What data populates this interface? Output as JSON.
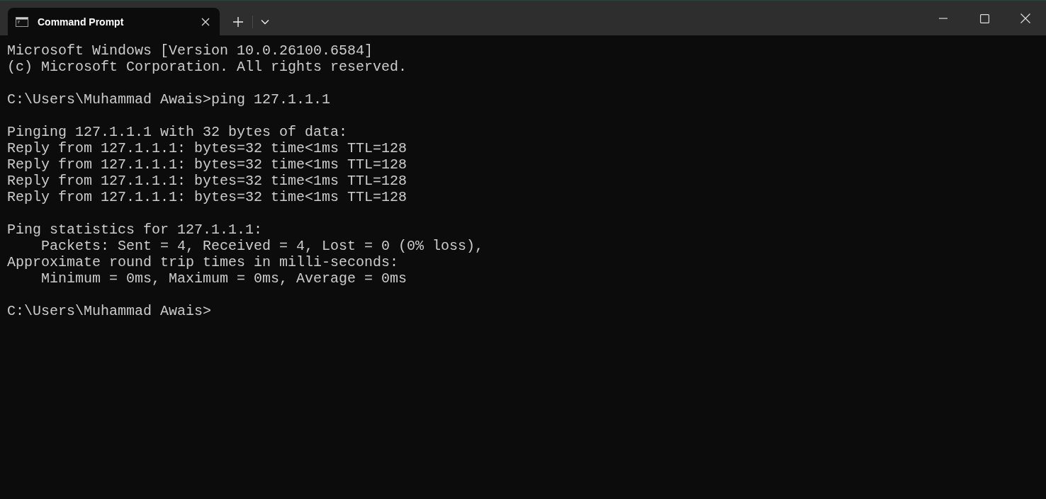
{
  "tabs": [
    {
      "title": "Command Prompt",
      "selected": true
    }
  ],
  "console": {
    "blocks": [
      [
        "Microsoft Windows [Version 10.0.26100.6584]",
        "(c) Microsoft Corporation. All rights reserved."
      ],
      [
        "C:\\Users\\Muhammad Awais>ping 127.1.1.1"
      ],
      [
        "Pinging 127.1.1.1 with 32 bytes of data:",
        "Reply from 127.1.1.1: bytes=32 time<1ms TTL=128",
        "Reply from 127.1.1.1: bytes=32 time<1ms TTL=128",
        "Reply from 127.1.1.1: bytes=32 time<1ms TTL=128",
        "Reply from 127.1.1.1: bytes=32 time<1ms TTL=128"
      ],
      [
        "Ping statistics for 127.1.1.1:",
        "    Packets: Sent = 4, Received = 4, Lost = 0 (0% loss),",
        "Approximate round trip times in milli-seconds:",
        "    Minimum = 0ms, Maximum = 0ms, Average = 0ms"
      ],
      [
        "C:\\Users\\Muhammad Awais>"
      ]
    ]
  }
}
